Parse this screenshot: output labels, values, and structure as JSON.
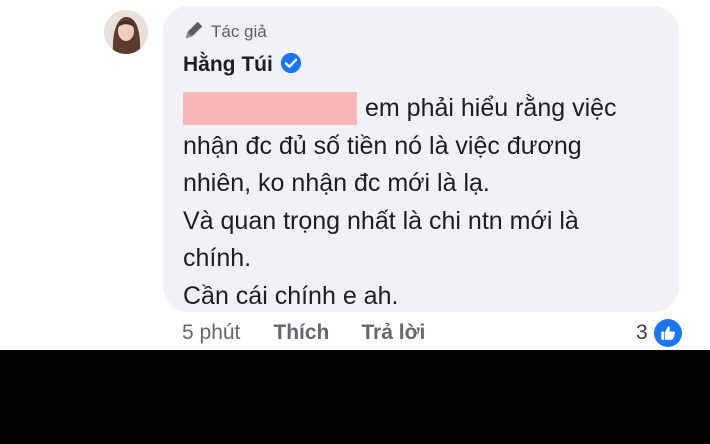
{
  "comment": {
    "role_label": "Tác giả",
    "author_name": "Hằng Túi",
    "lines": [
      "em phải hiểu rằng việc",
      "nhận đc đủ số tiền nó là việc đương",
      "nhiên, ko nhận đc mới là lạ.",
      "Và quan trọng nhất là chi ntn mới là",
      "chính.",
      "Cần cái chính e ah."
    ]
  },
  "actions": {
    "time": "5 phút",
    "like": "Thích",
    "reply": "Trả lời"
  },
  "reactions": {
    "count": "3",
    "icon": "thumbs-up-icon"
  },
  "colors": {
    "bubble": "#f0f2f5",
    "verified": "#1877f2",
    "redaction": "#f7b7b7",
    "secondary_text": "#65676b",
    "dark_band": "#030306"
  }
}
